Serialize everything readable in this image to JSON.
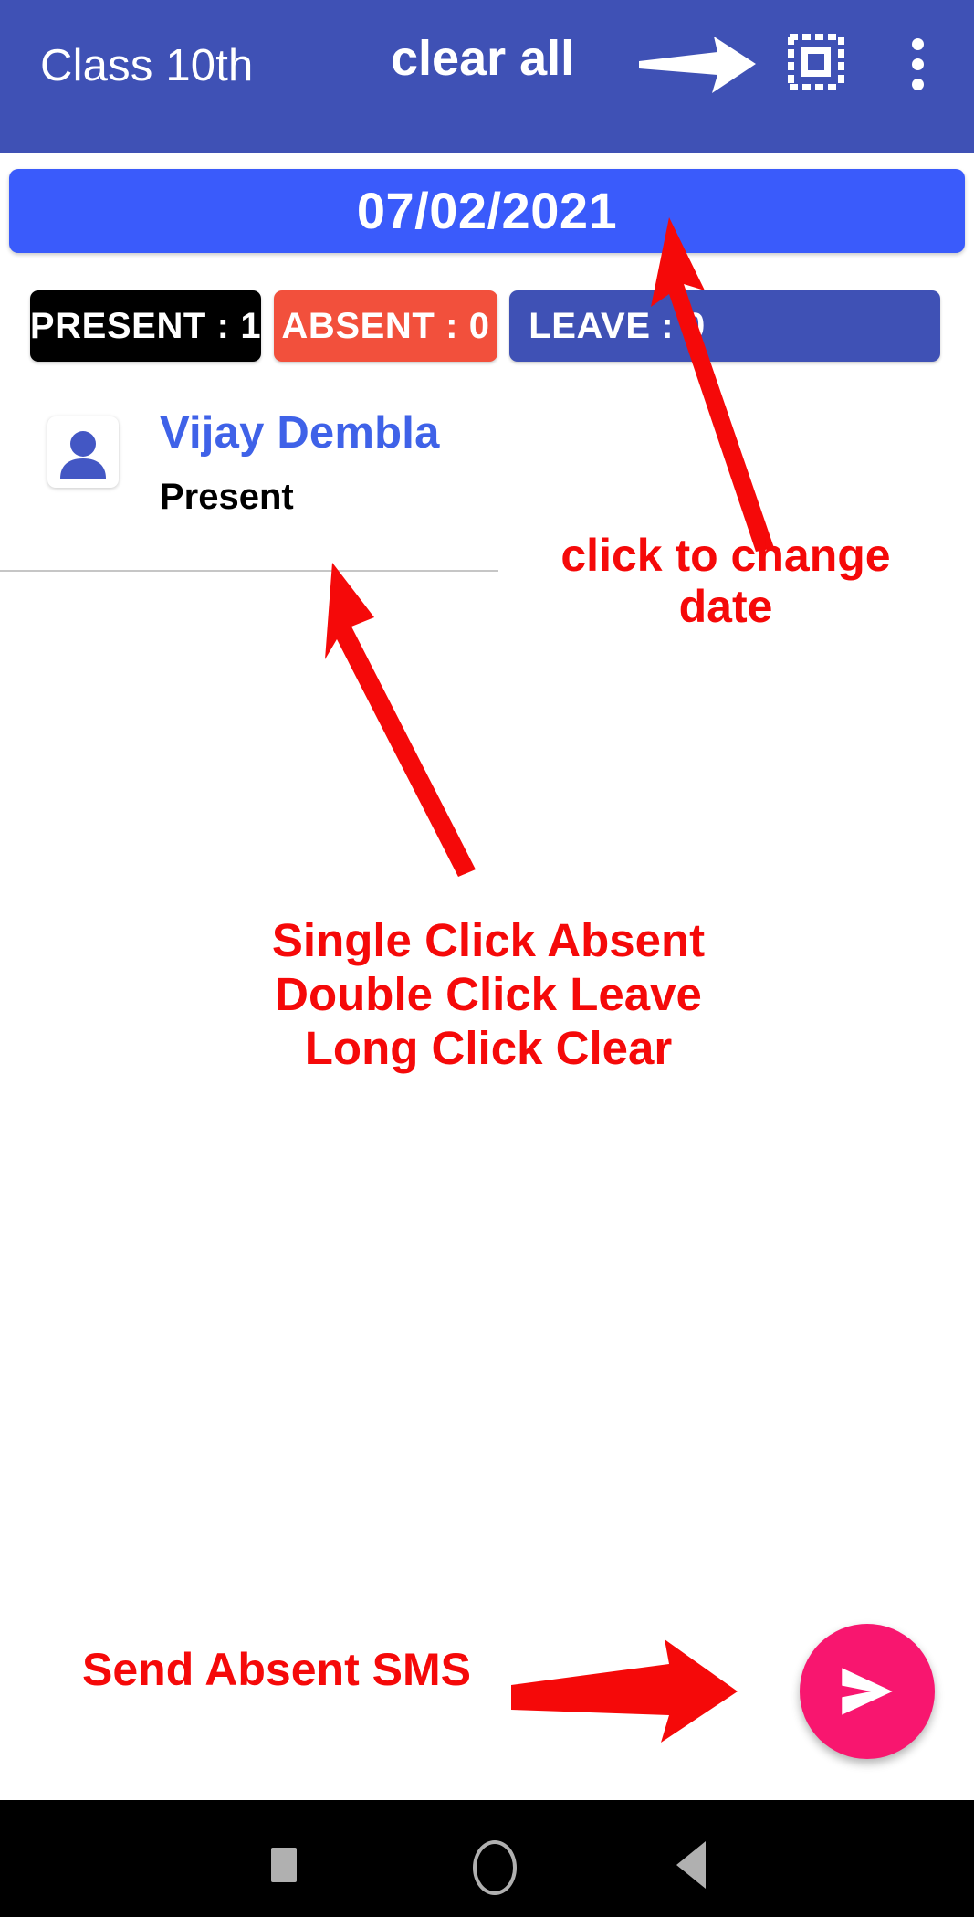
{
  "appbar": {
    "title": "Class 10th",
    "clear_all_label": "clear all",
    "select_all_icon": "select-all-icon",
    "overflow_icon": "more-vertical-icon",
    "background_color": "#3f51b5"
  },
  "date_button": {
    "value": "07/02/2021",
    "background_color": "#3a5bfb"
  },
  "summary": {
    "chips": [
      {
        "label": "PRESENT : 1",
        "color": "#000000",
        "name": "present"
      },
      {
        "label": "ABSENT : 0",
        "color": "#f2503c",
        "name": "absent"
      },
      {
        "label": "LEAVE : 0",
        "color": "#3f51b5",
        "name": "leave"
      }
    ]
  },
  "students": [
    {
      "name": "Vijay Dembla",
      "status": "Present",
      "avatar_icon": "person-placeholder-icon"
    }
  ],
  "annotations": {
    "change_date": "click to change\ndate",
    "click_help": "Single Click Absent\nDouble Click Leave\nLong Click Clear",
    "send_sms": "Send Absent SMS",
    "color": "#f50909"
  },
  "fab": {
    "icon": "send-icon",
    "color": "#f8166f"
  },
  "navbar": {
    "recents_icon": "square-recents-icon",
    "home_icon": "circle-home-icon",
    "back_icon": "triangle-back-icon"
  }
}
